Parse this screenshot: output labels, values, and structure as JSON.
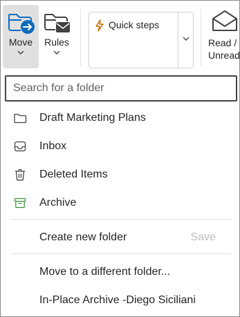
{
  "ribbon": {
    "move": {
      "label": "Move",
      "icon": "folder-move-icon",
      "chevron": "⌄"
    },
    "rules": {
      "label": "Rules",
      "icon": "folder-mail-icon",
      "chevron": "⌄"
    },
    "quick_steps": {
      "label": "Quick steps",
      "icon": "lightning-icon",
      "chevron": "⌄"
    },
    "read_unread": {
      "label_line1": "Read /",
      "label_line2": "Unread",
      "icon": "envelope-open-icon"
    }
  },
  "dropdown": {
    "search": {
      "placeholder": "Search for a folder",
      "value": ""
    },
    "folders": [
      {
        "label": "Draft Marketing Plans",
        "icon": "folder-icon"
      },
      {
        "label": "Inbox",
        "icon": "inbox-icon"
      },
      {
        "label": "Deleted Items",
        "icon": "trash-icon"
      },
      {
        "label": "Archive",
        "icon": "archive-icon"
      }
    ],
    "create_folder": {
      "label": "Create new folder",
      "save_label": "Save"
    },
    "move_different": {
      "label": "Move to a different folder..."
    },
    "in_place_archive": {
      "label": "In-Place Archive -Diego Siciliani"
    }
  },
  "colors": {
    "accent": "#0f6cbd",
    "archive_green": "#3f8f3f",
    "lightning_orange": "#c46a00",
    "selected_bg": "#e0e0e0",
    "disabled_text": "#bdbdbd"
  }
}
